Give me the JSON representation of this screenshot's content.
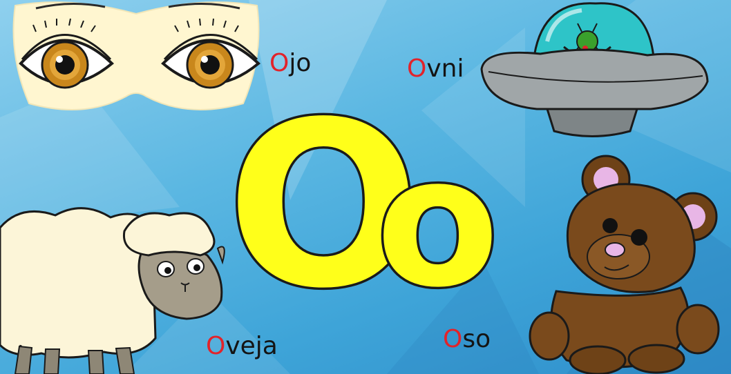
{
  "letter": {
    "uppercase": "O",
    "lowercase": "o",
    "fill_color": "#ffff1a",
    "outline_color": "#1a1a1a"
  },
  "words": [
    {
      "name": "ojo",
      "first": "O",
      "rest": "jo"
    },
    {
      "name": "ovni",
      "first": "O",
      "rest": "vni"
    },
    {
      "name": "oveja",
      "first": "O",
      "rest": "veja"
    },
    {
      "name": "oso",
      "first": "O",
      "rest": "so"
    }
  ],
  "colors": {
    "background": "#4fb0df",
    "highlight_letter": "#e2232a",
    "word_text": "#141414"
  },
  "pictures": [
    "eyes-illustration",
    "ufo-illustration",
    "sheep-illustration",
    "teddy-bear-illustration"
  ]
}
